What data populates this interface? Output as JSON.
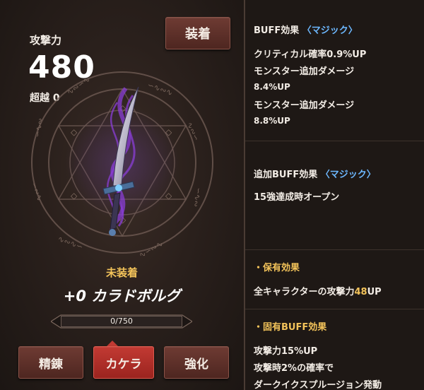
{
  "left_panel": {
    "attack_label": "攻撃力",
    "attack_value": "480",
    "transcend_label": "超越 0",
    "equip_button": "装着",
    "status": "未装着",
    "weapon_name": "+0 カラドボルグ",
    "progress_text": "0/750",
    "progress_fraction": 0.0,
    "buttons": {
      "refine": "精錬",
      "kakera": "カケラ",
      "enhance": "強化"
    }
  },
  "right_panel": {
    "buff": {
      "title": "BUFF効果",
      "tag": "〈マジック〉",
      "lines": [
        "クリティカル確率0.9%UP",
        "モンスター追加ダメージ",
        "8.4%UP",
        "モンスター追加ダメージ",
        "8.8%UP"
      ]
    },
    "extra_buff": {
      "title": "追加BUFF効果",
      "tag": "〈マジック〉",
      "lines": [
        "15強達成時オープン"
      ]
    },
    "owned": {
      "title": "・保有効果",
      "line_prefix": "全キャラクターの攻撃力",
      "line_value": "48",
      "line_suffix": "UP"
    },
    "unique": {
      "title": "・固有BUFF効果",
      "lines": [
        "攻撃力15%UP",
        "攻撃時2%の確率で",
        "ダークイクスプルージョン発動"
      ]
    }
  },
  "colors": {
    "gold": "#f3c35a",
    "blue_tag": "#6db8ff",
    "active_tab": "#c23a33",
    "button": "#5e3029"
  }
}
